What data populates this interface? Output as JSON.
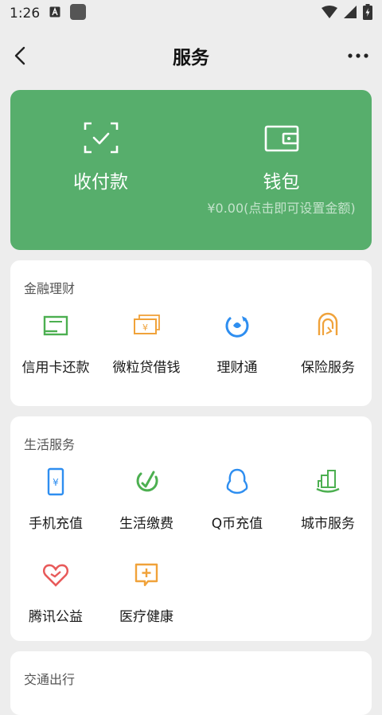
{
  "status_bar": {
    "time": "1:26"
  },
  "nav": {
    "title": "服务"
  },
  "hero": {
    "items": [
      {
        "label": "收付款"
      },
      {
        "label": "钱包",
        "sublabel": "¥0.00(点击即可设置金额)"
      }
    ]
  },
  "sections": [
    {
      "title": "金融理财",
      "items": [
        {
          "label": "信用卡还款",
          "icon": "credit-card-icon"
        },
        {
          "label": "微粒贷借钱",
          "icon": "banknote-icon"
        },
        {
          "label": "理财通",
          "icon": "licaitong-icon"
        },
        {
          "label": "保险服务",
          "icon": "insurance-icon"
        }
      ]
    },
    {
      "title": "生活服务",
      "items": [
        {
          "label": "手机充值",
          "icon": "phone-icon"
        },
        {
          "label": "生活缴费",
          "icon": "utility-bill-icon"
        },
        {
          "label": "Q币充值",
          "icon": "qq-penguin-icon"
        },
        {
          "label": "城市服务",
          "icon": "city-building-icon"
        },
        {
          "label": "腾讯公益",
          "icon": "charity-heart-icon"
        },
        {
          "label": "医疗健康",
          "icon": "medical-cross-icon"
        }
      ]
    },
    {
      "title": "交通出行"
    }
  ],
  "colors": {
    "hero_bg": "#57ae6c",
    "accent_green": "#4caf50",
    "accent_orange": "#f0a23a",
    "accent_blue": "#2e8ef0",
    "accent_red": "#e85a5a",
    "page_bg": "#ededed"
  }
}
